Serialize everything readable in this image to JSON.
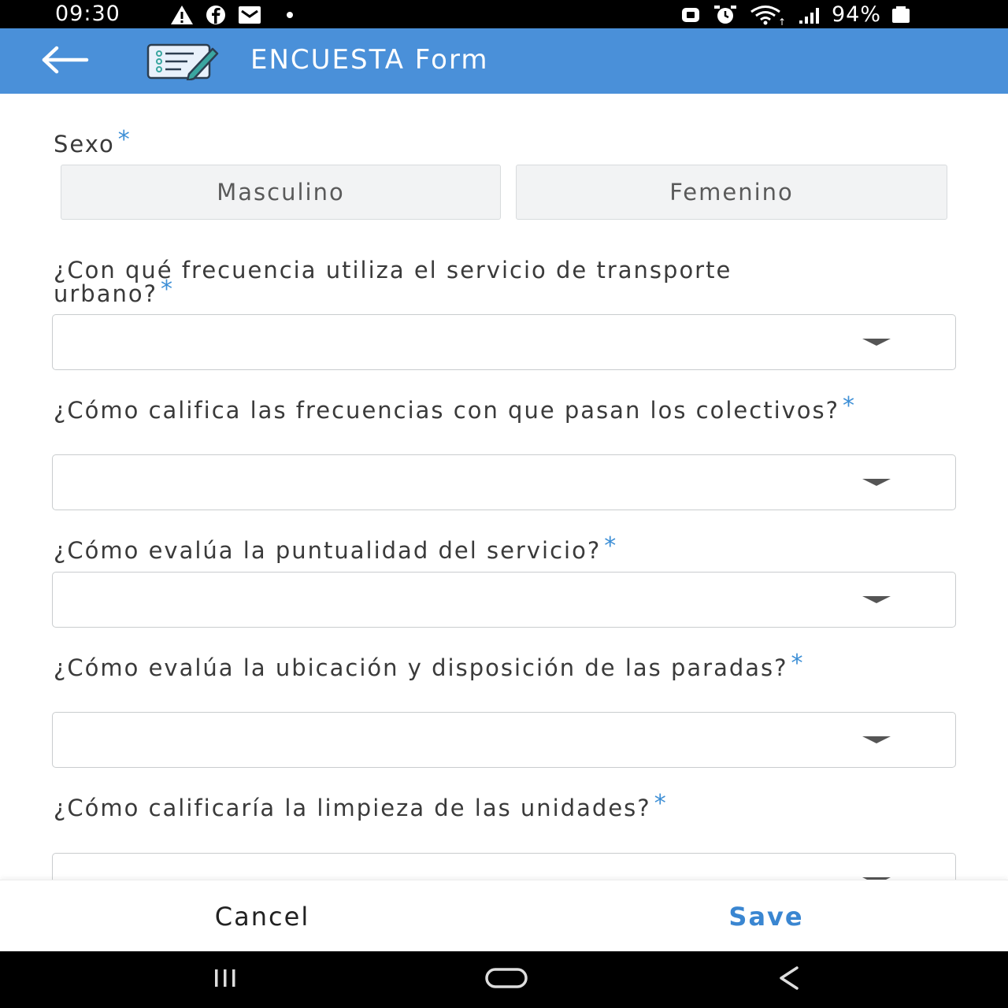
{
  "status_bar": {
    "time": "09:30",
    "battery": "94%",
    "icons": [
      "warning-icon",
      "facebook-icon",
      "mail-icon",
      "dot-icon",
      "battery-saver-icon",
      "alarm-icon",
      "wifi-icon",
      "signal-icon",
      "battery-icon"
    ]
  },
  "app_bar": {
    "title": "ENCUESTA Form",
    "back_icon": "arrow-left-icon",
    "logo_icon": "survey-form-icon",
    "color": "#4a90d9"
  },
  "form": {
    "required_mark": "*",
    "required_color": "#3d8fd6",
    "sexo": {
      "label": "Sexo",
      "options": [
        "Masculino",
        "Femenino"
      ]
    },
    "questions": [
      {
        "label": "¿Con qué frecuencia utiliza el servicio de transporte urbano?",
        "value": ""
      },
      {
        "label": "¿Cómo califica las frecuencias con que pasan los colectivos?",
        "value": ""
      },
      {
        "label": "¿Cómo evalúa la puntualidad del servicio?",
        "value": ""
      },
      {
        "label": "¿Cómo evalúa la ubicación y disposición de las paradas?",
        "value": ""
      },
      {
        "label": "¿Cómo calificaría la limpieza de las unidades?",
        "value": ""
      }
    ]
  },
  "actions": {
    "cancel_label": "Cancel",
    "save_label": "Save",
    "save_color": "#3a86d1"
  },
  "nav_bar": {
    "icons": [
      "recent-apps-icon",
      "home-icon",
      "back-icon"
    ]
  }
}
